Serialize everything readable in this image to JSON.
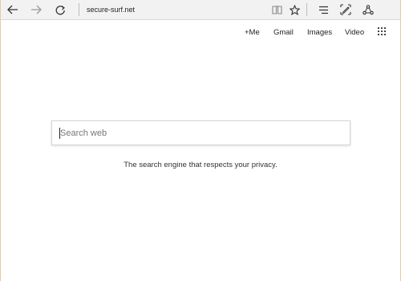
{
  "browser": {
    "url": "secure-surf.net",
    "buttons": [
      "back-icon",
      "forward-icon",
      "refresh-icon",
      "reading-view-icon",
      "favorite-star-icon",
      "hub-icon",
      "web-note-icon",
      "share-icon"
    ]
  },
  "topnav": {
    "links": [
      "+Me",
      "Gmail",
      "Images",
      "Video"
    ],
    "apps_icon": "apps-grid-icon"
  },
  "search": {
    "placeholder": "Search web",
    "value": ""
  },
  "tagline": "The search engine that respects your privacy.",
  "colors": {
    "toolbar_bg": "#f2f2f2",
    "page_bg": "#ffffff",
    "text": "#222222"
  }
}
